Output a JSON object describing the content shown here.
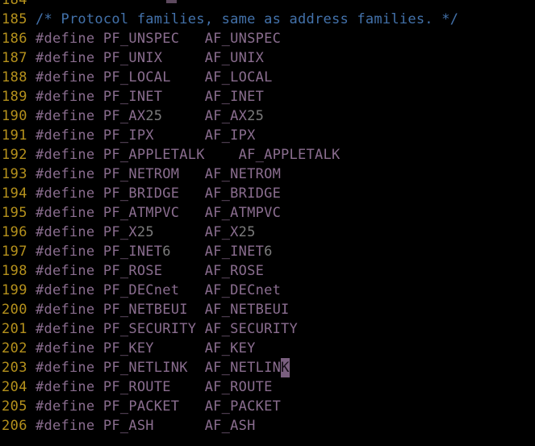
{
  "editor": {
    "name": "source-code-view",
    "background_color": "#000000",
    "line_number_color": "#b5911c",
    "identifier_color": "#8a6d8f",
    "number_literal_color": "#7c7c7c",
    "comment_color": "#4372ab",
    "cursor_background_color": "#7a5f7f",
    "cursor_foreground_color": "#120c14",
    "cursor_line_number": "203",
    "cursor_character": "K",
    "first_visible_line": "184",
    "last_visible_line": "206"
  },
  "lines": [
    {
      "number": "184",
      "text": "",
      "tokens": []
    },
    {
      "number": "185",
      "text": "/* Protocol families, same as address families. */",
      "tokens": [
        {
          "type": "comment",
          "text": "/* Protocol families, same as address families. */"
        }
      ]
    },
    {
      "number": "186",
      "text": "#define PF_UNSPEC\tAF_UNSPEC",
      "tokens": [
        {
          "type": "plain",
          "text": "#define PF_UNSPEC   AF_UNSPEC"
        }
      ]
    },
    {
      "number": "187",
      "text": "#define PF_UNIX\t\tAF_UNIX",
      "tokens": [
        {
          "type": "plain",
          "text": "#define PF_UNIX     AF_UNIX"
        }
      ]
    },
    {
      "number": "188",
      "text": "#define PF_LOCAL\tAF_LOCAL",
      "tokens": [
        {
          "type": "plain",
          "text": "#define PF_LOCAL    AF_LOCAL"
        }
      ]
    },
    {
      "number": "189",
      "text": "#define PF_INET\t\tAF_INET",
      "tokens": [
        {
          "type": "plain",
          "text": "#define PF_INET     AF_INET"
        }
      ]
    },
    {
      "number": "190",
      "text": "#define PF_AX25\t\tAF_AX25",
      "tokens": [
        {
          "type": "plain",
          "text": "#define PF_AX"
        },
        {
          "type": "number",
          "text": "25"
        },
        {
          "type": "plain",
          "text": "     AF_AX"
        },
        {
          "type": "number",
          "text": "25"
        }
      ]
    },
    {
      "number": "191",
      "text": "#define PF_IPX\t\tAF_IPX",
      "tokens": [
        {
          "type": "plain",
          "text": "#define PF_IPX      AF_IPX"
        }
      ]
    },
    {
      "number": "192",
      "text": "#define PF_APPLETALK\tAF_APPLETALK",
      "tokens": [
        {
          "type": "plain",
          "text": "#define PF_APPLETALK    AF_APPLETALK"
        }
      ]
    },
    {
      "number": "193",
      "text": "#define PF_NETROM\tAF_NETROM",
      "tokens": [
        {
          "type": "plain",
          "text": "#define PF_NETROM   AF_NETROM"
        }
      ]
    },
    {
      "number": "194",
      "text": "#define PF_BRIDGE\tAF_BRIDGE",
      "tokens": [
        {
          "type": "plain",
          "text": "#define PF_BRIDGE   AF_BRIDGE"
        }
      ]
    },
    {
      "number": "195",
      "text": "#define PF_ATMPVC\tAF_ATMPVC",
      "tokens": [
        {
          "type": "plain",
          "text": "#define PF_ATMPVC   AF_ATMPVC"
        }
      ]
    },
    {
      "number": "196",
      "text": "#define PF_X25\t\tAF_X25",
      "tokens": [
        {
          "type": "plain",
          "text": "#define PF_X"
        },
        {
          "type": "number",
          "text": "25"
        },
        {
          "type": "plain",
          "text": "      AF_X"
        },
        {
          "type": "number",
          "text": "25"
        }
      ]
    },
    {
      "number": "197",
      "text": "#define PF_INET6\tAF_INET6",
      "tokens": [
        {
          "type": "plain",
          "text": "#define PF_INET"
        },
        {
          "type": "number",
          "text": "6"
        },
        {
          "type": "plain",
          "text": "    AF_INET"
        },
        {
          "type": "number",
          "text": "6"
        }
      ]
    },
    {
      "number": "198",
      "text": "#define PF_ROSE\t\tAF_ROSE",
      "tokens": [
        {
          "type": "plain",
          "text": "#define PF_ROSE     AF_ROSE"
        }
      ]
    },
    {
      "number": "199",
      "text": "#define PF_DECnet\tAF_DECnet",
      "tokens": [
        {
          "type": "plain",
          "text": "#define PF_DECnet   AF_DECnet"
        }
      ]
    },
    {
      "number": "200",
      "text": "#define PF_NETBEUI\tAF_NETBEUI",
      "tokens": [
        {
          "type": "plain",
          "text": "#define PF_NETBEUI  AF_NETBEUI"
        }
      ]
    },
    {
      "number": "201",
      "text": "#define PF_SECURITY\tAF_SECURITY",
      "tokens": [
        {
          "type": "plain",
          "text": "#define PF_SECURITY AF_SECURITY"
        }
      ]
    },
    {
      "number": "202",
      "text": "#define PF_KEY\t\tAF_KEY",
      "tokens": [
        {
          "type": "plain",
          "text": "#define PF_KEY      AF_KEY"
        }
      ]
    },
    {
      "number": "203",
      "text": "#define PF_NETLINK\tAF_NETLINK",
      "tokens": [
        {
          "type": "plain",
          "text": "#define PF_NETLINK  AF_NETLIN"
        },
        {
          "type": "cursor",
          "text": "K"
        }
      ]
    },
    {
      "number": "204",
      "text": "#define PF_ROUTE\tAF_ROUTE",
      "tokens": [
        {
          "type": "plain",
          "text": "#define PF_ROUTE    AF_ROUTE"
        }
      ]
    },
    {
      "number": "205",
      "text": "#define PF_PACKET\tAF_PACKET",
      "tokens": [
        {
          "type": "plain",
          "text": "#define PF_PACKET   AF_PACKET"
        }
      ]
    },
    {
      "number": "206",
      "text": "#define PF_ASH\t\tAF_ASH",
      "tokens": [
        {
          "type": "plain",
          "text": "#define PF_ASH      AF_ASH"
        }
      ]
    }
  ]
}
